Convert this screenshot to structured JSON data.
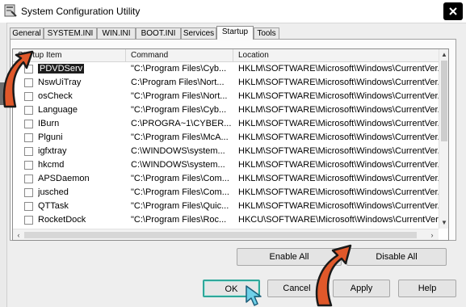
{
  "window": {
    "title": "System Configuration Utility"
  },
  "tabs": [
    "General",
    "SYSTEM.INI",
    "WIN.INI",
    "BOOT.INI",
    "Services",
    "Startup",
    "Tools"
  ],
  "active_tab": "Startup",
  "list": {
    "columns": [
      "Startup Item",
      "Command",
      "Location"
    ],
    "rows": [
      {
        "item": "PDVDServ",
        "command": "\"C:\\Program Files\\Cyb...",
        "location": "HKLM\\SOFTWARE\\Microsoft\\Windows\\CurrentVer...",
        "selected": true
      },
      {
        "item": "NswUiTray",
        "command": "C:\\Program Files\\Nort...",
        "location": "HKLM\\SOFTWARE\\Microsoft\\Windows\\CurrentVer..."
      },
      {
        "item": "osCheck",
        "command": "\"C:\\Program Files\\Nort...",
        "location": "HKLM\\SOFTWARE\\Microsoft\\Windows\\CurrentVer..."
      },
      {
        "item": "Language",
        "command": "\"C:\\Program Files\\Cyb...",
        "location": "HKLM\\SOFTWARE\\Microsoft\\Windows\\CurrentVer..."
      },
      {
        "item": "IBurn",
        "command": "C:\\PROGRA~1\\CYBER...",
        "location": "HKLM\\SOFTWARE\\Microsoft\\Windows\\CurrentVer..."
      },
      {
        "item": "Plguni",
        "command": "\"C:\\Program Files\\McA...",
        "location": "HKLM\\SOFTWARE\\Microsoft\\Windows\\CurrentVer..."
      },
      {
        "item": "igfxtray",
        "command": "C:\\WINDOWS\\system...",
        "location": "HKLM\\SOFTWARE\\Microsoft\\Windows\\CurrentVer..."
      },
      {
        "item": "hkcmd",
        "command": "C:\\WINDOWS\\system...",
        "location": "HKLM\\SOFTWARE\\Microsoft\\Windows\\CurrentVer..."
      },
      {
        "item": "APSDaemon",
        "command": "\"C:\\Program Files\\Com...",
        "location": "HKLM\\SOFTWARE\\Microsoft\\Windows\\CurrentVer..."
      },
      {
        "item": "jusched",
        "command": "\"C:\\Program Files\\Com...",
        "location": "HKLM\\SOFTWARE\\Microsoft\\Windows\\CurrentVer..."
      },
      {
        "item": "QTTask",
        "command": "\"C:\\Program Files\\Quic...",
        "location": "HKLM\\SOFTWARE\\Microsoft\\Windows\\CurrentVer..."
      },
      {
        "item": "RocketDock",
        "command": "\"C:\\Program Files\\Roc...",
        "location": "HKCU\\SOFTWARE\\Microsoft\\Windows\\CurrentVer..."
      }
    ]
  },
  "buttons": {
    "enable_all": "Enable All",
    "disable_all": "Disable All",
    "ok": "OK",
    "cancel": "Cancel",
    "apply": "Apply",
    "help": "Help"
  },
  "colors": {
    "highlight_arrow": "#e0582a",
    "ok_focus": "#2fa79a",
    "selection": "#1e1e1e"
  },
  "icons": [
    "app-icon",
    "close-icon",
    "checkbox",
    "scroll-up-icon",
    "scroll-down-icon",
    "scroll-left-icon",
    "scroll-right-icon",
    "cursor-icon",
    "annotation-arrow"
  ]
}
